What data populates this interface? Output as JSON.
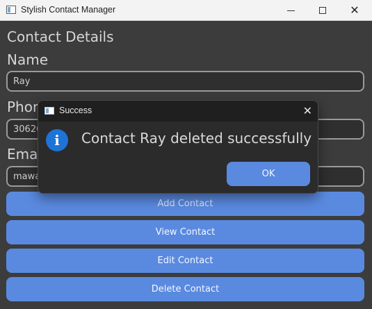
{
  "window": {
    "title": "Stylish Contact Manager",
    "minimize_icon": "minimize-icon",
    "maximize_icon": "maximize-icon",
    "close_icon": "close-icon",
    "close_glyph": "✕"
  },
  "form": {
    "heading": "Contact Details",
    "name_label": "Name",
    "name_value": "Ray",
    "phone_label": "Phone",
    "phone_value": "30626",
    "email_label": "Email",
    "email_value": "mawa"
  },
  "buttons": {
    "add": "Add Contact",
    "view": "View Contact",
    "edit": "Edit Contact",
    "delete": "Delete Contact"
  },
  "dialog": {
    "title": "Success",
    "message": "Contact Ray deleted successfully",
    "ok": "OK",
    "icon": "info-icon",
    "info_glyph": "i",
    "close_glyph": "✕"
  },
  "colors": {
    "accent": "#5a8ae0",
    "background": "#3c3c3c",
    "info_blue": "#1e73d6"
  }
}
